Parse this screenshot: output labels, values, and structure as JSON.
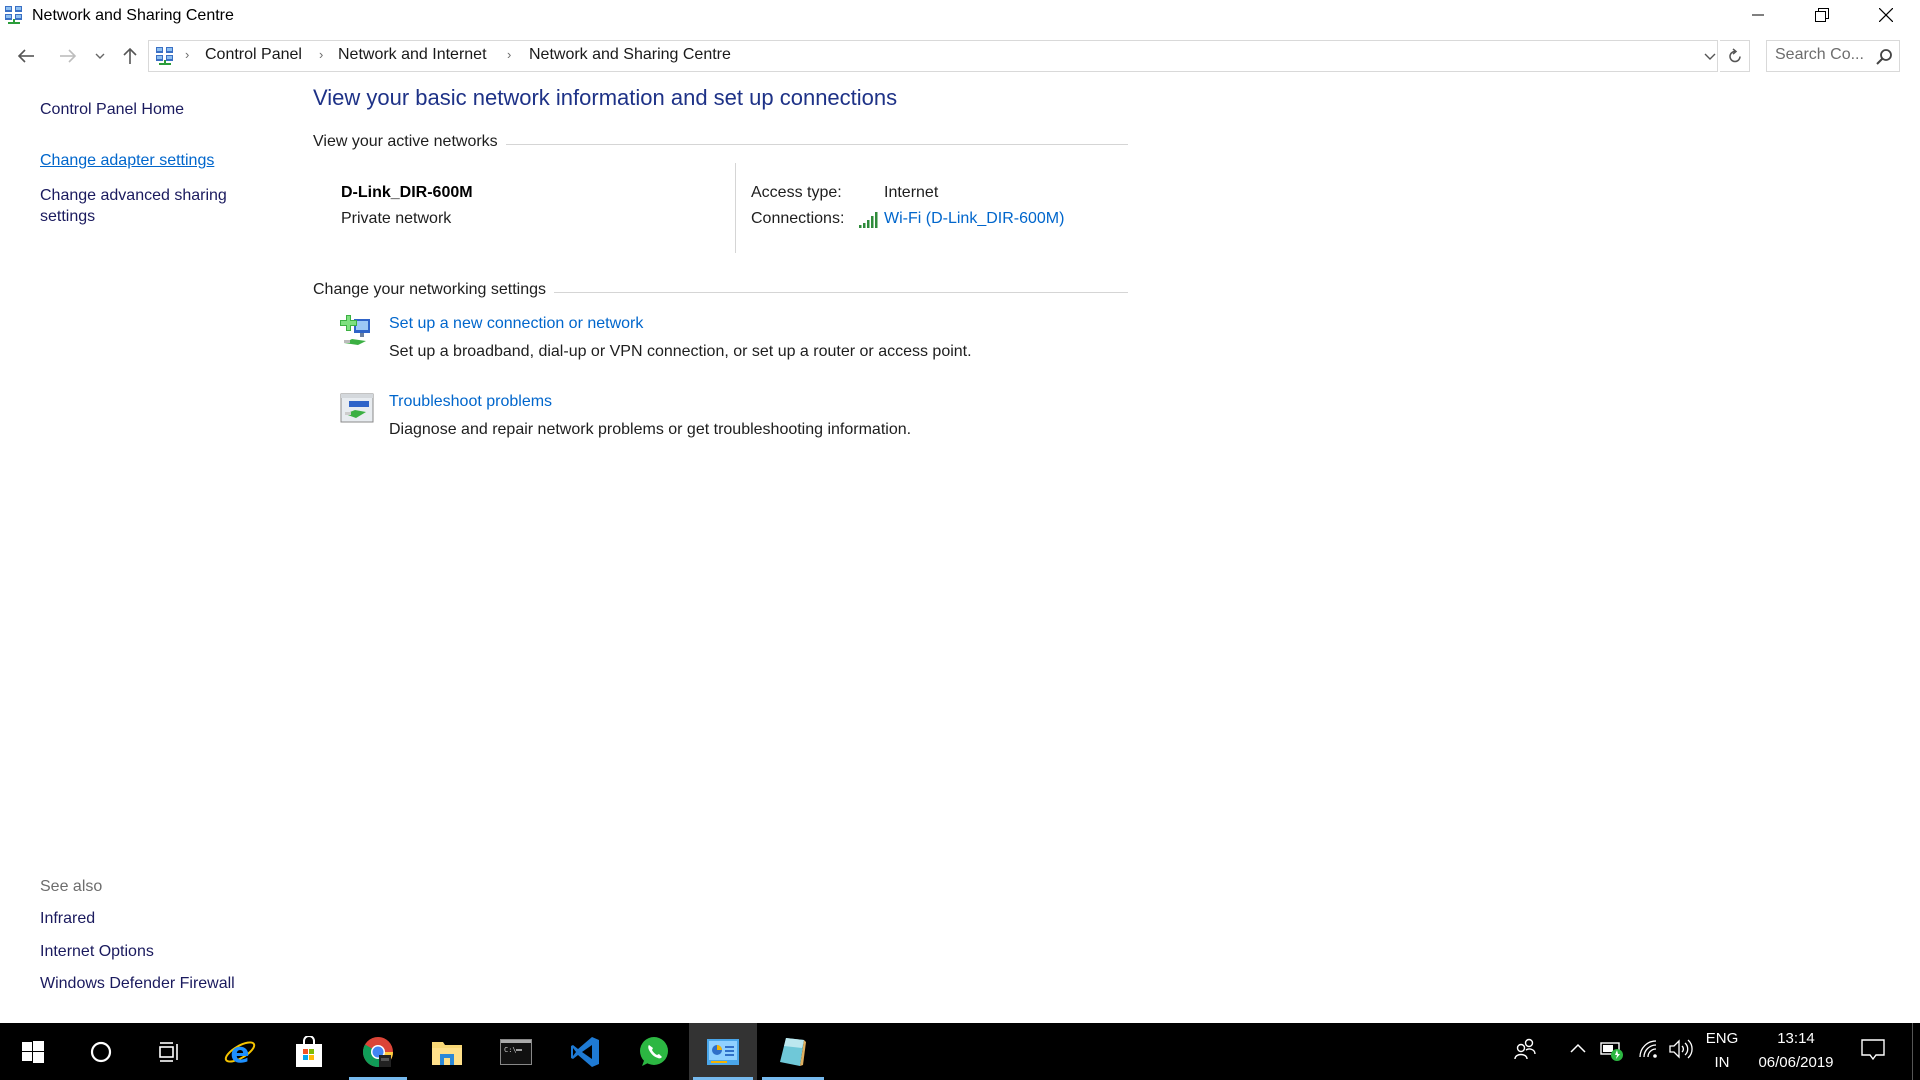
{
  "window": {
    "title": "Network and Sharing Centre",
    "controls": {
      "minimize": "minimize",
      "maximize": "restore",
      "close": "close"
    }
  },
  "address_bar": {
    "breadcrumbs": [
      "Control Panel",
      "Network and Internet",
      "Network and Sharing Centre"
    ],
    "search_placeholder": "Search Co..."
  },
  "sidebar": {
    "links": [
      {
        "label": "Control Panel Home",
        "active": false
      },
      {
        "label": "Change adapter settings",
        "active": true
      },
      {
        "label": "Change advanced sharing settings",
        "active": false
      }
    ],
    "see_also_title": "See also",
    "see_also": [
      "Infrared",
      "Internet Options",
      "Windows Defender Firewall"
    ]
  },
  "main": {
    "heading": "View your basic network information and set up connections",
    "active_networks": {
      "section_title": "View your active networks",
      "network_name": "D-Link_DIR-600M",
      "network_type": "Private network",
      "access_type_label": "Access type:",
      "access_type_value": "Internet",
      "connections_label": "Connections:",
      "connection_link": "Wi-Fi (D-Link_DIR-600M)",
      "signal_icon": "wifi-signal-full"
    },
    "change_settings": {
      "section_title": "Change your networking settings",
      "tasks": [
        {
          "icon": "new-connection-icon",
          "link": "Set up a new connection or network",
          "description": "Set up a broadband, dial-up or VPN connection, or set up a router or access point."
        },
        {
          "icon": "troubleshoot-icon",
          "link": "Troubleshoot problems",
          "description": "Diagnose and repair network problems or get troubleshooting information."
        }
      ]
    }
  },
  "taskbar": {
    "apps": [
      {
        "name": "start",
        "icon": "windows-logo-icon",
        "running": false,
        "active": false
      },
      {
        "name": "cortana",
        "icon": "cortana-circle-icon",
        "running": false,
        "active": false
      },
      {
        "name": "task-view",
        "icon": "task-view-icon",
        "running": false,
        "active": false
      },
      {
        "name": "internet-explorer",
        "icon": "ie-icon",
        "running": false,
        "active": false
      },
      {
        "name": "store",
        "icon": "store-bag-icon",
        "running": false,
        "active": false
      },
      {
        "name": "chrome",
        "icon": "chrome-icon",
        "running": true,
        "active": false
      },
      {
        "name": "file-explorer",
        "icon": "folder-icon",
        "running": false,
        "active": false
      },
      {
        "name": "command-prompt",
        "icon": "cmd-icon",
        "running": false,
        "active": false
      },
      {
        "name": "vs-code",
        "icon": "vscode-icon",
        "running": false,
        "active": false
      },
      {
        "name": "whatsapp",
        "icon": "whatsapp-icon",
        "running": false,
        "active": false
      },
      {
        "name": "control-panel",
        "icon": "control-panel-icon",
        "running": true,
        "active": true
      },
      {
        "name": "notepad",
        "icon": "notepad-icon",
        "running": true,
        "active": false
      }
    ],
    "tray": {
      "language_line1": "ENG",
      "language_line2": "IN",
      "time": "13:14",
      "date": "06/06/2019"
    }
  },
  "colors": {
    "link": "#0066cc",
    "heading": "#1e3287",
    "sidebar_text": "#1a1a5e",
    "taskbar_bg": "#000000",
    "taskbar_active": "#333333",
    "taskbar_indicator": "#76b9ed"
  }
}
